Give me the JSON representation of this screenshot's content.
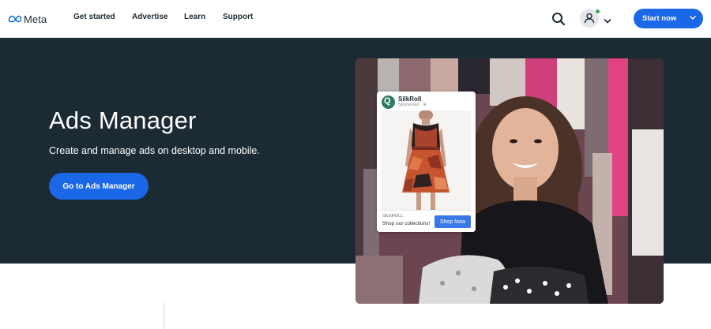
{
  "nav": {
    "logo_text": "Meta",
    "links": [
      "Get started",
      "Advertise",
      "Learn",
      "Support"
    ],
    "search_icon": "search-icon",
    "avatar_icon": "user-icon",
    "status_color": "#31a24c",
    "start_label": "Start now"
  },
  "hero": {
    "title": "Ads Manager",
    "subtitle": "Create and manage ads on desktop and mobile.",
    "cta_label": "Go to Ads Manager"
  },
  "ad_preview": {
    "brand_initial": "Q",
    "brand_name": "SilkRoll",
    "sponsored": "Sponsored · ⊕",
    "domain": "SILKROLL",
    "tagline": "Shop our collections!",
    "button_label": "Shop Now"
  },
  "colors": {
    "brand_blue": "#1a67e8",
    "hero_bg": "#1c2b33",
    "text_dark": "#1c2b33"
  }
}
